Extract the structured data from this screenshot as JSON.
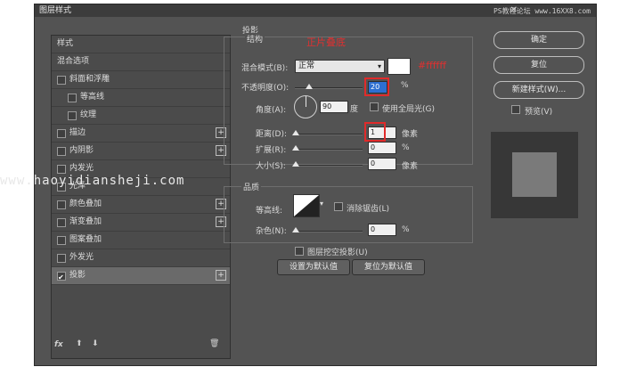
{
  "window": {
    "title": "图层样式",
    "watermark": "PS教程论坛 www.16XX8.com",
    "close_icon": "close-icon"
  },
  "style_list": {
    "header": "样式",
    "items": [
      {
        "label": "混合选项",
        "checkbox": false,
        "plus": false,
        "checked": false
      },
      {
        "label": "斜面和浮雕",
        "checkbox": true,
        "plus": false,
        "checked": false
      },
      {
        "label": "等高线",
        "checkbox": true,
        "plus": false,
        "checked": false,
        "indent": true
      },
      {
        "label": "纹理",
        "checkbox": true,
        "plus": false,
        "checked": false,
        "indent": true
      },
      {
        "label": "描边",
        "checkbox": true,
        "plus": true,
        "checked": false
      },
      {
        "label": "内阴影",
        "checkbox": true,
        "plus": true,
        "checked": false
      },
      {
        "label": "内发光",
        "checkbox": true,
        "plus": false,
        "checked": false
      },
      {
        "label": "光泽",
        "checkbox": true,
        "plus": false,
        "checked": false
      },
      {
        "label": "颜色叠加",
        "checkbox": true,
        "plus": true,
        "checked": false
      },
      {
        "label": "渐变叠加",
        "checkbox": true,
        "plus": true,
        "checked": false
      },
      {
        "label": "图案叠加",
        "checkbox": true,
        "plus": false,
        "checked": false
      },
      {
        "label": "外发光",
        "checkbox": true,
        "plus": false,
        "checked": false
      },
      {
        "label": "投影",
        "checkbox": true,
        "plus": true,
        "checked": true
      }
    ],
    "fx_label": "fx"
  },
  "shadow": {
    "group_title": "投影",
    "structure_title": "结构",
    "annotation_blend": "正片叠底",
    "annotation_color": "#ffffff",
    "blend_mode_label": "混合模式(B):",
    "blend_mode_value": "正常",
    "color_swatch": "#ffffff",
    "opacity_label": "不透明度(O):",
    "opacity_value": "20",
    "opacity_unit": "%",
    "angle_label": "角度(A):",
    "angle_value": "90",
    "angle_unit": "度",
    "global_light_label": "使用全局光(G)",
    "distance_label": "距离(D):",
    "distance_value": "1",
    "distance_unit": "像素",
    "spread_label": "扩展(R):",
    "spread_value": "0",
    "spread_unit": "%",
    "size_label": "大小(S):",
    "size_value": "0",
    "size_unit": "像素",
    "quality_title": "品质",
    "contour_label": "等高线:",
    "antialias_label": "消除锯齿(L)",
    "noise_label": "杂色(N):",
    "noise_value": "0",
    "noise_unit": "%",
    "knockout_label": "图层挖空投影(U)",
    "set_default": "设置为默认值",
    "reset_default": "复位为默认值"
  },
  "buttons": {
    "ok": "确定",
    "reset": "复位",
    "new_style": "新建样式(W)...",
    "preview_label": "预览(V)"
  },
  "watermark_site": "www.haoyidiansheji.com"
}
